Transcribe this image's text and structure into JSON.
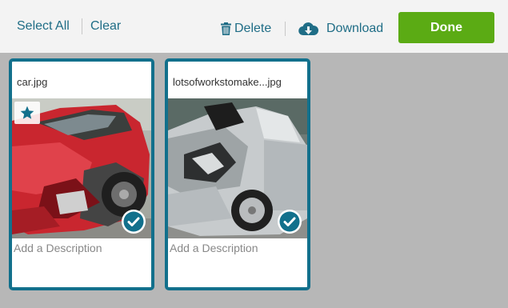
{
  "toolbar": {
    "select_all": "Select All",
    "clear": "Clear",
    "delete": "Delete",
    "download": "Download",
    "done": "Done"
  },
  "colors": {
    "accent": "#1f6d86",
    "card_border": "#12708c",
    "done_button": "#5bab14",
    "background": "#b7b7b7"
  },
  "cards": [
    {
      "filename": "car.jpg",
      "starred": true,
      "selected": true,
      "description_placeholder": "Add a Description",
      "icons": [
        "star-icon",
        "check-circle-icon"
      ]
    },
    {
      "filename": "lotsofworkstomake...jpg",
      "starred": false,
      "selected": true,
      "description_placeholder": "Add a Description",
      "icons": [
        "check-circle-icon"
      ]
    }
  ]
}
